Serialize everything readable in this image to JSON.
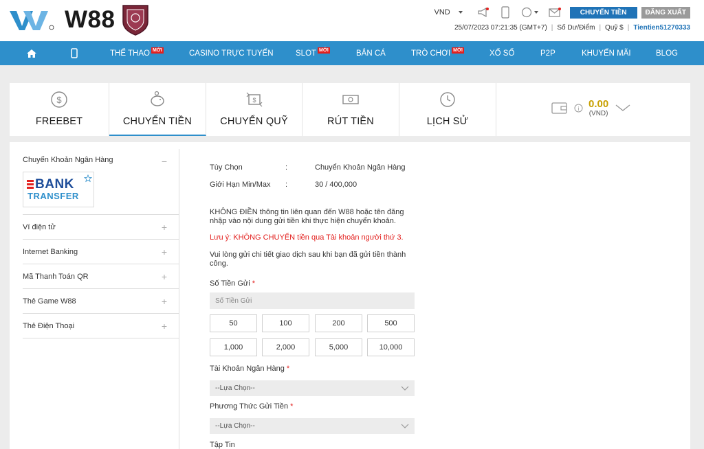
{
  "header": {
    "brand": "W88",
    "currency": "VND",
    "transfer_button": "CHUYỂN TIỀN",
    "logout_button": "ĐĂNG XUẤT",
    "datetime": "25/07/2023 07:21:35 (GMT+7)",
    "points_label": "Số Dư/Điểm",
    "fund_label": "Quỹ $",
    "username": "Tientien51270333",
    "icons": [
      "megaphone-icon",
      "mobile-icon",
      "circle-icon",
      "mail-icon"
    ]
  },
  "nav": {
    "items": [
      {
        "label": "",
        "icon": "home-icon"
      },
      {
        "label": "",
        "icon": "mobile-icon"
      },
      {
        "label": "THỂ THAO",
        "badge": "MỚI"
      },
      {
        "label": "CASINO TRỰC TUYẾN"
      },
      {
        "label": "SLOT",
        "badge": "MỚI"
      },
      {
        "label": "BẮN CÁ"
      },
      {
        "label": "TRÒ CHƠI",
        "badge": "MỚI"
      },
      {
        "label": "XỔ SỐ"
      },
      {
        "label": "P2P"
      },
      {
        "label": "KHUYẾN MÃI"
      },
      {
        "label": "BLOG"
      }
    ]
  },
  "tabs": [
    {
      "label": "FREEBET",
      "icon": "dollar-coin-icon"
    },
    {
      "label": "CHUYỂN TIỀN",
      "icon": "piggy-bank-icon",
      "active": true
    },
    {
      "label": "CHUYỂN QUỸ",
      "icon": "transfer-icon"
    },
    {
      "label": "RÚT TIỀN",
      "icon": "cash-icon"
    },
    {
      "label": "LỊCH SỬ",
      "icon": "history-icon"
    }
  ],
  "wallet": {
    "amount": "0.00",
    "currency": "(VND)"
  },
  "sidebar": {
    "expanded": {
      "label": "Chuyển Khoản Ngân Hàng",
      "toggle": "−",
      "logo_line1": "BANK",
      "logo_line2": "TRANSFER"
    },
    "items": [
      {
        "label": "Ví điện tử",
        "toggle": "+"
      },
      {
        "label": "Internet Banking",
        "toggle": "+"
      },
      {
        "label": "Mã Thanh Toán QR",
        "toggle": "+"
      },
      {
        "label": "Thẻ Game W88",
        "toggle": "+"
      },
      {
        "label": "Thẻ Điện Thoại",
        "toggle": "+"
      }
    ]
  },
  "form": {
    "option_label": "Tùy Chọn",
    "option_value": "Chuyển Khoản Ngân Hàng",
    "limit_label": "Giới Hạn Min/Max",
    "limit_value": "30 / 400,000",
    "colon": ":",
    "note1": "KHÔNG ĐIỀN thông tin liên quan đến W88 hoặc tên đăng nhập vào nội dung gửi tiền khi thực hiện chuyển khoản.",
    "note2": "Lưu ý: KHÔNG CHUYỂN tiền qua Tài khoản người thứ 3.",
    "note3": "Vui lòng gửi chi tiết giao dịch sau khi bạn đã gửi tiền thành công.",
    "amount_label": "Số Tiền Gửi",
    "amount_placeholder": "Số Tiền Gửi",
    "required_mark": "*",
    "amounts": [
      "50",
      "100",
      "200",
      "500",
      "1,000",
      "2,000",
      "5,000",
      "10,000"
    ],
    "bank_account_label": "Tài Khoản Ngân Hàng",
    "bank_account_value": "--Lựa Chọn--",
    "method_label": "Phương Thức Gửi Tiền",
    "method_value": "--Lựa Chọn--",
    "file_label": "Tập Tin"
  },
  "colors": {
    "nav_blue": "#2e8fcb",
    "accent_blue": "#1f73b7",
    "gold": "#c8a000",
    "red": "#e3211f"
  }
}
